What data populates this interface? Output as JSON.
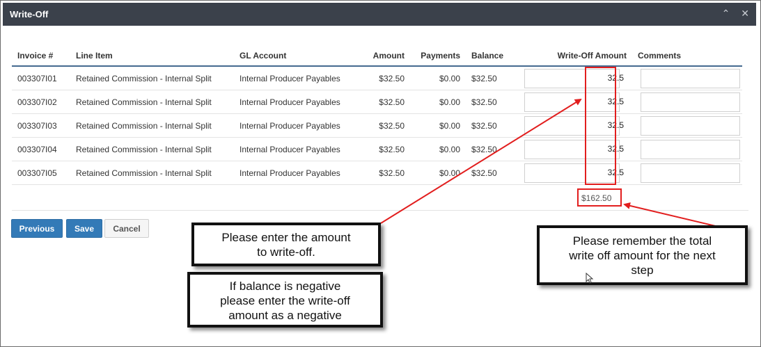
{
  "window": {
    "title": "Write-Off"
  },
  "table": {
    "headers": [
      "Invoice #",
      "Line Item",
      "GL Account",
      "Amount",
      "Payments",
      "Balance",
      "Write-Off Amount",
      "Comments"
    ],
    "rows": [
      {
        "invoice": "003307I01",
        "line_item": "Retained Commission - Internal Split",
        "gl_account": "Internal Producer Payables",
        "amount": "$32.50",
        "payments": "$0.00",
        "balance": "$32.50",
        "write_off": "32.5",
        "comment": ""
      },
      {
        "invoice": "003307I02",
        "line_item": "Retained Commission - Internal Split",
        "gl_account": "Internal Producer Payables",
        "amount": "$32.50",
        "payments": "$0.00",
        "balance": "$32.50",
        "write_off": "32.5",
        "comment": ""
      },
      {
        "invoice": "003307I03",
        "line_item": "Retained Commission - Internal Split",
        "gl_account": "Internal Producer Payables",
        "amount": "$32.50",
        "payments": "$0.00",
        "balance": "$32.50",
        "write_off": "32.5",
        "comment": ""
      },
      {
        "invoice": "003307I04",
        "line_item": "Retained Commission - Internal Split",
        "gl_account": "Internal Producer Payables",
        "amount": "$32.50",
        "payments": "$0.00",
        "balance": "$32.50",
        "write_off": "32.5",
        "comment": ""
      },
      {
        "invoice": "003307I05",
        "line_item": "Retained Commission - Internal Split",
        "gl_account": "Internal Producer Payables",
        "amount": "$32.50",
        "payments": "$0.00",
        "balance": "$32.50",
        "write_off": "32.5",
        "comment": ""
      }
    ],
    "total": "$162.50"
  },
  "buttons": {
    "previous": "Previous",
    "save": "Save",
    "cancel": "Cancel"
  },
  "annotations": {
    "enter_amount": [
      "Please enter the amount",
      "to write-off."
    ],
    "negative": [
      "If balance is negative",
      "please enter the write-off",
      "amount as a negative"
    ],
    "remember_total": [
      "Please remember the total",
      "write off amount for the next",
      "step"
    ]
  },
  "colors": {
    "titlebar": "#3b414b",
    "accent": "#337ab7",
    "annotation_red": "#e21e1e"
  }
}
